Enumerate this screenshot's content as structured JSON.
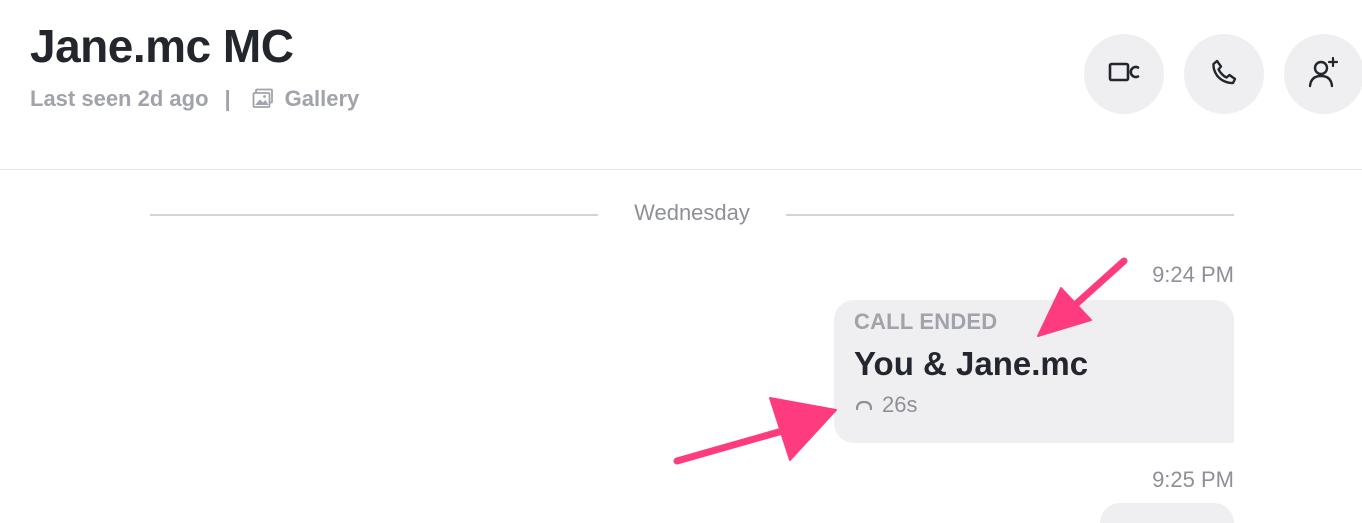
{
  "header": {
    "contact_name": "Jane.mc MC",
    "last_seen": "Last seen 2d ago",
    "separator": "|",
    "gallery_label": "Gallery",
    "actions": [
      {
        "name": "video-call",
        "icon": "video-camera-icon"
      },
      {
        "name": "voice-call",
        "icon": "phone-icon"
      },
      {
        "name": "add-participant",
        "icon": "add-person-icon"
      }
    ]
  },
  "conversation": {
    "day_divider": "Wednesday",
    "messages": [
      {
        "time": "9:24 PM",
        "type": "call",
        "status": "CALL ENDED",
        "parties": "You & Jane.mc",
        "duration": "26s",
        "duration_icon": "phone-hangup-icon"
      },
      {
        "time": "9:25 PM"
      }
    ]
  },
  "annotations": {
    "arrow_color": "#ff3b7f",
    "arrows": [
      "arrow-pointing-call-status",
      "arrow-pointing-call-duration"
    ]
  },
  "colors": {
    "primary_text": "#24262d",
    "muted_text": "#a1a3aa",
    "bubble_bg": "#efeff1",
    "button_bg": "#efeff1"
  }
}
